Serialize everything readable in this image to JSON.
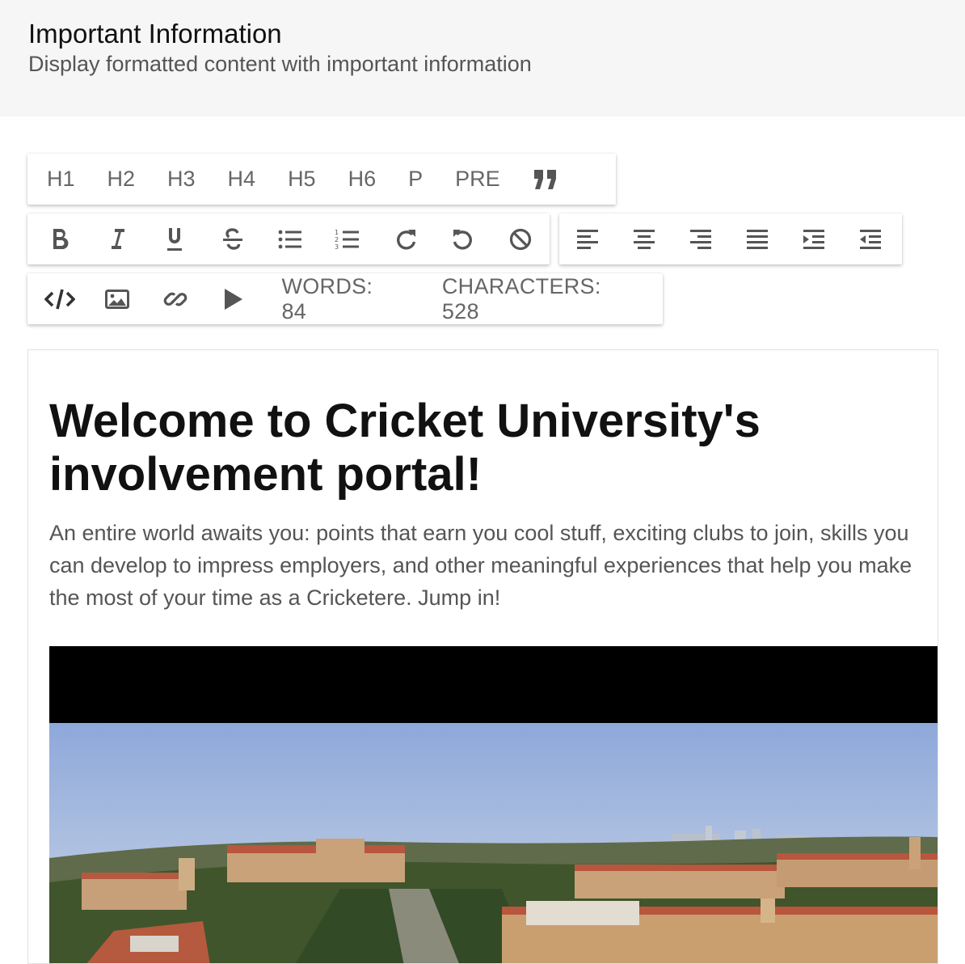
{
  "header": {
    "title": "Important Information",
    "subtitle": "Display formatted content with important information"
  },
  "toolbar_headings": {
    "h1": "H1",
    "h2": "H2",
    "h3": "H3",
    "h4": "H4",
    "h5": "H5",
    "h6": "H6",
    "p": "P",
    "pre": "PRE",
    "quote": "”"
  },
  "toolbar_format": {
    "bold_icon": "bold-icon",
    "italic_icon": "italic-icon",
    "underline_icon": "underline-icon",
    "strike_icon": "strikethrough-icon",
    "bullet_icon": "bulleted-list-icon",
    "number_icon": "numbered-list-icon",
    "redo_icon": "redo-icon",
    "undo_icon": "undo-icon",
    "clear_icon": "clear-format-icon"
  },
  "toolbar_align": {
    "left": "align-left-icon",
    "center": "align-center-icon",
    "right": "align-right-icon",
    "justify": "align-justify-icon",
    "indent": "indent-icon",
    "outdent": "outdent-icon"
  },
  "toolbar_media": {
    "code_icon": "code-icon",
    "image_icon": "image-icon",
    "link_icon": "link-icon",
    "video_icon": "play-icon",
    "words": "WORDS: 84",
    "characters": "CHARACTERS: 528"
  },
  "editor": {
    "heading": "Welcome to Cricket University's involvement portal!",
    "body": "An entire world awaits you: points that earn you cool stuff, exciting clubs to join, skills you can develop to impress employers, and other meaningful experiences that help you make the most of your time as a Cricketere. Jump in!"
  },
  "colors": {
    "icon": "#555555",
    "header_bg": "#f6f6f6",
    "sky_top": "#8fa8d8",
    "sky_bottom": "#c7d4e6",
    "roof": "#b8563e",
    "stone": "#c9a27a",
    "trees": "#3e5a2c"
  }
}
